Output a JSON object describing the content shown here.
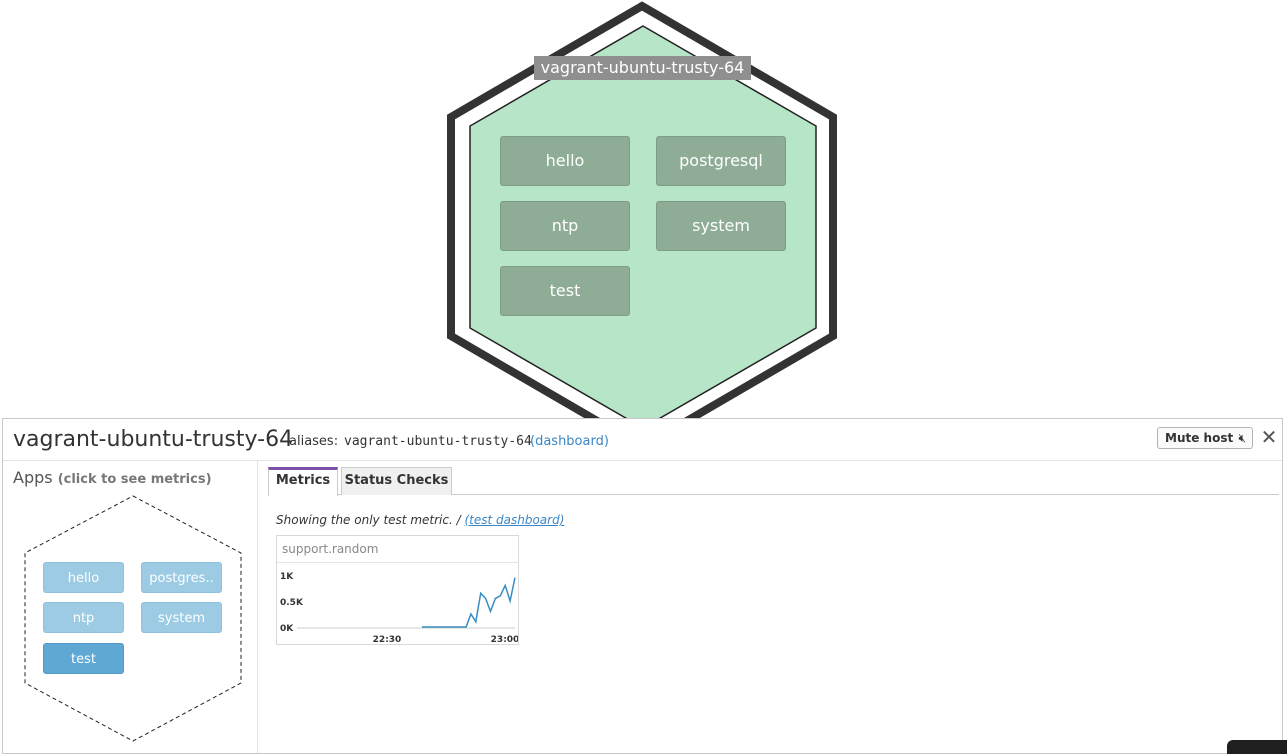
{
  "hostmap": {
    "host_title": "vagrant-ubuntu-trusty-64",
    "apps": [
      "hello",
      "postgresql",
      "ntp",
      "system",
      "test"
    ]
  },
  "panel": {
    "host_name": "vagrant-ubuntu-trusty-64",
    "aliases_label": "aliases:",
    "aliases_value": "vagrant-ubuntu-trusty-64",
    "dashboard_link": "(dashboard)",
    "mute_button": "Mute host",
    "mute_icon": "speaker-muted-icon",
    "close_icon": "close-icon",
    "apps_title": "Apps",
    "apps_hint": "(click to see metrics)",
    "apps": [
      {
        "label": "hello",
        "active": false
      },
      {
        "label": "postgres..",
        "active": false
      },
      {
        "label": "ntp",
        "active": false
      },
      {
        "label": "system",
        "active": false
      },
      {
        "label": "test",
        "active": true
      }
    ],
    "tabs": [
      {
        "label": "Metrics",
        "active": true
      },
      {
        "label": "Status Checks",
        "active": false
      }
    ],
    "metric_note": "Showing the only test metric. /",
    "test_dashboard_link": "(test dashboard)"
  },
  "colors": {
    "hex_fill": "#b7e5c7",
    "hex_border": "#333333",
    "app_tile": "#8fad96",
    "mini_app": "#9ccbe3",
    "mini_app_active": "#5fa8d3",
    "tab_accent": "#7a52a6",
    "link": "#3a86c4",
    "series": "#3a8dc0"
  },
  "chart_data": {
    "type": "line",
    "title": "support.random",
    "y_tick_labels": [
      "1K",
      "0.5K",
      "0K"
    ],
    "x_tick_labels": [
      "22:30",
      "23:00"
    ],
    "ylim": [
      0,
      1000
    ],
    "series": [
      {
        "values": [
          0,
          0,
          0,
          0,
          0,
          0,
          0,
          0,
          0,
          0,
          250,
          100,
          650,
          550,
          300,
          550,
          600,
          800,
          500,
          950
        ]
      }
    ]
  }
}
